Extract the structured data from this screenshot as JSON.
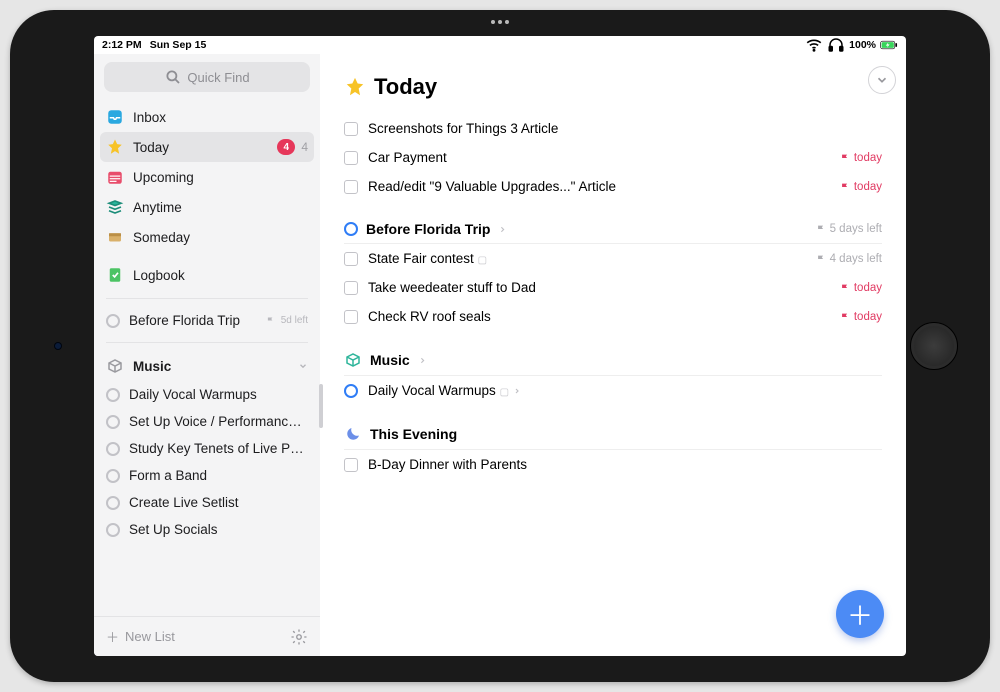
{
  "status": {
    "time": "2:12 PM",
    "date": "Sun Sep 15",
    "battery": "100%"
  },
  "quickfind_placeholder": "Quick Find",
  "sidebar": {
    "top": [
      {
        "id": "inbox",
        "label": "Inbox"
      },
      {
        "id": "today",
        "label": "Today",
        "red": "4",
        "count": "4"
      },
      {
        "id": "upcoming",
        "label": "Upcoming"
      },
      {
        "id": "anytime",
        "label": "Anytime"
      },
      {
        "id": "someday",
        "label": "Someday"
      },
      {
        "id": "logbook",
        "label": "Logbook"
      }
    ],
    "projects": [
      {
        "label": "Before Florida Trip",
        "tag": "5d left"
      }
    ],
    "area": {
      "name": "Music",
      "items": [
        {
          "label": "Daily Vocal Warmups"
        },
        {
          "label": "Set Up Voice / Performance Les..."
        },
        {
          "label": "Study Key Tenets of Live Perfor..."
        },
        {
          "label": "Form a Band"
        },
        {
          "label": "Create Live Setlist"
        },
        {
          "label": "Set Up Socials"
        }
      ]
    },
    "newlist": "New List"
  },
  "main": {
    "title": "Today",
    "group0": [
      {
        "text": "Screenshots for Things 3 Article"
      },
      {
        "text": "Car Payment",
        "due": "today"
      },
      {
        "text": "Read/edit \"9 Valuable Upgrades...\" Article",
        "due": "today"
      }
    ],
    "section1": {
      "title": "Before Florida Trip",
      "tag": "5 days left"
    },
    "group1": [
      {
        "text": "State Fair contest",
        "note": true,
        "tag_grey": "4 days left"
      },
      {
        "text": "Take weedeater stuff to Dad",
        "due": "today"
      },
      {
        "text": "Check RV roof seals",
        "due": "today"
      }
    ],
    "section2": {
      "title": "Music"
    },
    "group2": [
      {
        "text": "Daily Vocal Warmups",
        "note": true,
        "proj": true
      }
    ],
    "section3": {
      "title": "This Evening"
    },
    "group3": [
      {
        "text": "B-Day Dinner with Parents"
      }
    ]
  }
}
